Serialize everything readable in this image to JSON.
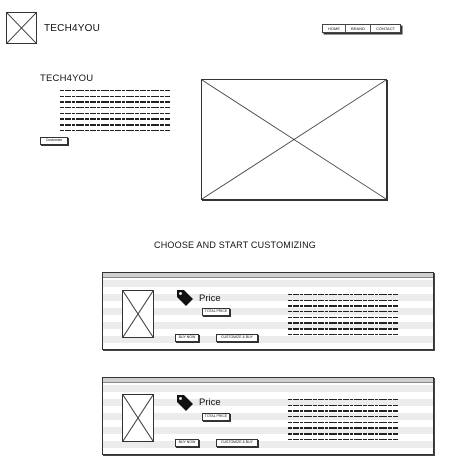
{
  "header": {
    "brand": "TECH4YOU",
    "nav": [
      "HOME",
      "BRAND",
      "CONTACT"
    ]
  },
  "hero": {
    "title": "TECH4YOU",
    "button_label": "Customize"
  },
  "section": {
    "title": "CHOOSE AND START CUSTOMIZING"
  },
  "products": [
    {
      "price_label": "Price",
      "price_value": "TOTAL PRICE",
      "buy_label": "BUY NOW",
      "customize_label": "CUSTOMIZE & BUY"
    },
    {
      "price_label": "Price",
      "price_value": "TOTAL PRICE",
      "buy_label": "BUY NOW",
      "customize_label": "CUSTOMIZE & BUY"
    }
  ],
  "icons": {
    "logo": "image-placeholder-icon",
    "tag": "price-tag-icon"
  }
}
